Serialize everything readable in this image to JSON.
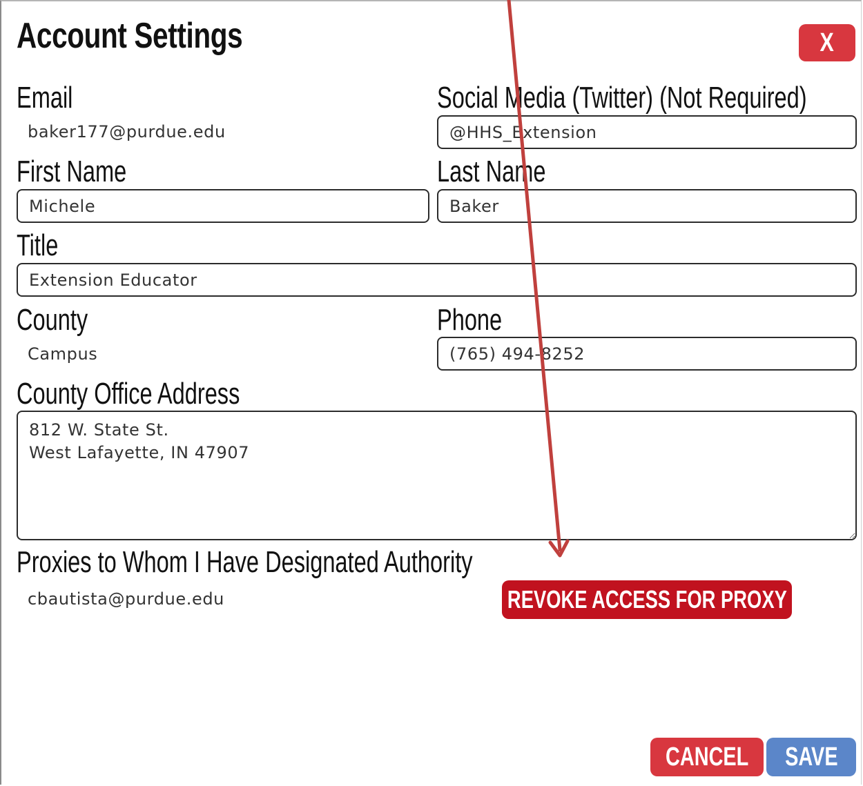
{
  "dialog": {
    "title": "Account Settings",
    "close_label": "X"
  },
  "fields": {
    "email": {
      "label": "Email",
      "value": "baker177@purdue.edu"
    },
    "social": {
      "label": "Social Media (Twitter) (Not Required)",
      "value": "@HHS_Extension"
    },
    "first_name": {
      "label": "First Name",
      "value": "Michele"
    },
    "last_name": {
      "label": "Last Name",
      "value": "Baker"
    },
    "title": {
      "label": "Title",
      "value": "Extension Educator"
    },
    "county": {
      "label": "County",
      "value": "Campus"
    },
    "phone": {
      "label": "Phone",
      "value": "(765) 494-8252"
    },
    "address": {
      "label": "County Office Address",
      "value": "812 W. State St.\nWest Lafayette, IN 47907"
    }
  },
  "proxies": {
    "label": "Proxies to Whom I Have Designated Authority",
    "email": "cbautista@purdue.edu",
    "revoke_label": "REVOKE ACCESS FOR PROXY"
  },
  "footer": {
    "cancel_label": "CANCEL",
    "save_label": "SAVE"
  },
  "colors": {
    "close_button": "#d8373f",
    "revoke_button": "#c1121f",
    "cancel_button": "#d8373f",
    "save_button": "#5b86c9",
    "annotation_arrow": "#c0403d"
  },
  "icons": {
    "resize": "resize-grip-icon",
    "annotation": "annotation-arrow-icon"
  }
}
